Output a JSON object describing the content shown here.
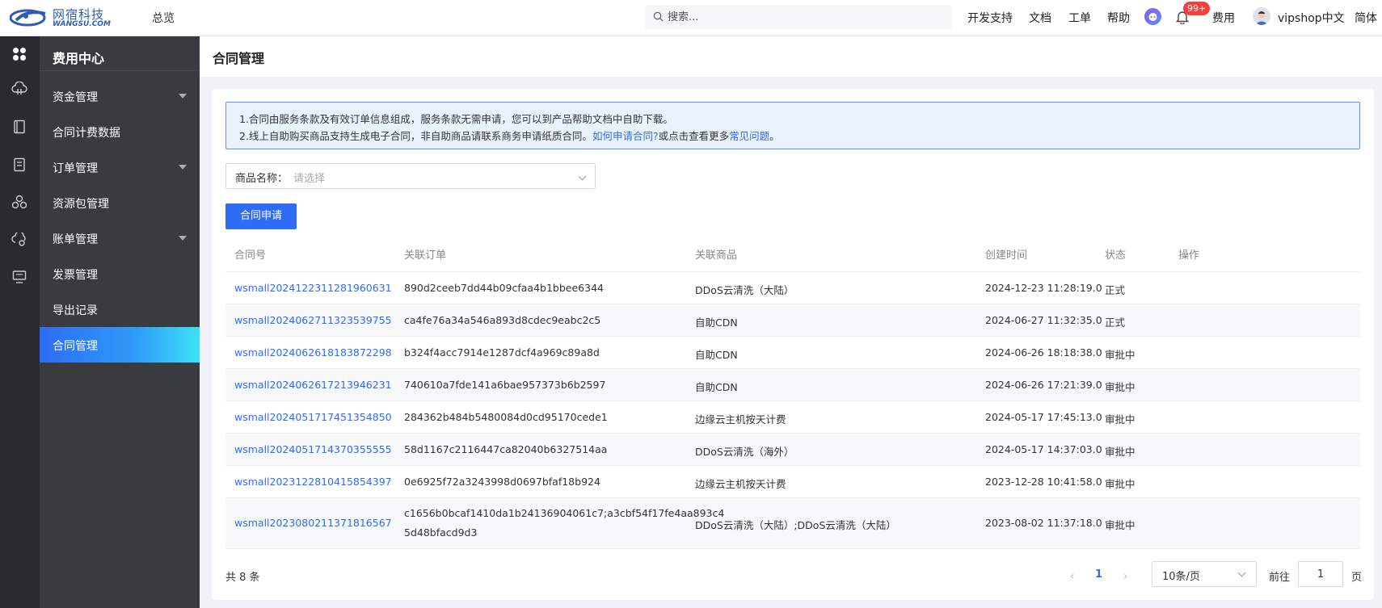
{
  "colors": {
    "accent": "#2e6cf6",
    "sidebar": "#3a3b3e",
    "rail": "#2a2b2e",
    "badge": "#f5413d"
  },
  "header": {
    "logo_cn": "网宿科技",
    "logo_en": "WANGSU.COM",
    "overview": "总览",
    "search_placeholder": "搜索...",
    "nav": [
      "开发支持",
      "文档",
      "工单",
      "帮助"
    ],
    "notification_badge": "99+",
    "billing": "费用",
    "username": "vipshop中文",
    "language": "简体"
  },
  "rail_icons": [
    "grid-icon",
    "cloud-icon",
    "book-icon",
    "document-icon",
    "cubes-icon",
    "cloud-link-icon",
    "monitor-icon"
  ],
  "sidebar": {
    "title": "费用中心",
    "items": [
      {
        "label": "资金管理",
        "expandable": true
      },
      {
        "label": "合同计费数据",
        "expandable": false
      },
      {
        "label": "订单管理",
        "expandable": true
      },
      {
        "label": "资源包管理",
        "expandable": false
      },
      {
        "label": "账单管理",
        "expandable": true
      },
      {
        "label": "发票管理",
        "expandable": false
      },
      {
        "label": "导出记录",
        "expandable": false
      },
      {
        "label": "合同管理",
        "expandable": false,
        "active": true
      }
    ]
  },
  "page": {
    "title": "合同管理"
  },
  "notice": {
    "line1": "1.合同由服务条款及有效订单信息组成，服务条款无需申请，您可以到产品帮助文档中自助下载。",
    "line2_prefix": "2.线上自助购买商品支持生成电子合同，非自助商品请联系商务申请纸质合同。",
    "line2_link1": "如何申请合同?",
    "line2_mid": "或点击查看更多",
    "line2_link2": "常见问题",
    "line2_suffix": "。"
  },
  "filter": {
    "label": "商品名称：",
    "placeholder": "请选择"
  },
  "apply_button": "合同申请",
  "table": {
    "columns": [
      "合同号",
      "关联订单",
      "关联商品",
      "创建时间",
      "状态",
      "操作"
    ],
    "rows": [
      {
        "id": "wsmall2024122311281960631",
        "order": "890d2ceeb7dd44b09cfaa4b1bbee6344",
        "order2": "",
        "product": "DDoS云清洗（大陆）",
        "created": "2024-12-23 11:28:19.0",
        "status": "正式"
      },
      {
        "id": "wsmall2024062711323539755",
        "order": "ca4fe76a34a546a893d8cdec9eabc2c5",
        "order2": "",
        "product": "自助CDN",
        "created": "2024-06-27 11:32:35.0",
        "status": "正式"
      },
      {
        "id": "wsmall2024062618183872298",
        "order": "b324f4acc7914e1287dcf4a969c89a8d",
        "order2": "",
        "product": "自助CDN",
        "created": "2024-06-26 18:18:38.0",
        "status": "审批中"
      },
      {
        "id": "wsmall2024062617213946231",
        "order": "740610a7fde141a6bae957373b6b2597",
        "order2": "",
        "product": "自助CDN",
        "created": "2024-06-26 17:21:39.0",
        "status": "审批中"
      },
      {
        "id": "wsmall2024051717451354850",
        "order": "284362b484b5480084d0cd95170cede1",
        "order2": "",
        "product": "边缘云主机按天计费",
        "created": "2024-05-17 17:45:13.0",
        "status": "审批中"
      },
      {
        "id": "wsmall2024051714370355555",
        "order": "58d1167c2116447ca82040b6327514aa",
        "order2": "",
        "product": "DDoS云清洗（海外）",
        "created": "2024-05-17 14:37:03.0",
        "status": "审批中"
      },
      {
        "id": "wsmall2023122810415854397",
        "order": "0e6925f72a3243998d0697bfaf18b924",
        "order2": "",
        "product": "边缘云主机按天计费",
        "created": "2023-12-28 10:41:58.0",
        "status": "审批中"
      },
      {
        "id": "wsmall2023080211371816567",
        "order": "c1656b0bcaf1410da1b24136904061c7;a3cbf54f17fe4aa893c4",
        "order2": "5d48bfacd9d3",
        "product": "DDoS云清洗（大陆）;DDoS云清洗（大陆）",
        "created": "2023-08-02 11:37:18.0",
        "status": "审批中"
      }
    ]
  },
  "pagination": {
    "total": "共 8 条",
    "current_page": "1",
    "page_size": "10条/页",
    "goto_label": "前往",
    "goto_value": "1",
    "page_unit": "页"
  }
}
